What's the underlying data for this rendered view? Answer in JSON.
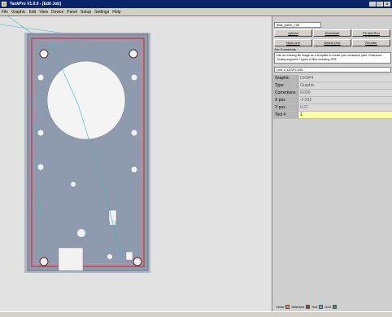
{
  "window": {
    "title": "TankPro V1.0.0 - [Edit Job]",
    "buttons": [
      "_",
      "□",
      "X"
    ]
  },
  "menu": {
    "items": [
      "File",
      "Graphic",
      "Edit",
      "View",
      "Device",
      "Panel",
      "Setup",
      "Settings",
      "Help"
    ]
  },
  "panel": {
    "job_name": "disa_panel_f.06",
    "buttons": {
      "upload": "Upload",
      "download": "Download",
      "fit_run": "Fit and Run",
      "new_line": "New Line",
      "delete_line": "Delete Line",
      "reorder": "Reorder"
    },
    "job_comments_label": "Job Comments",
    "job_comments": "Use an existing file image as a template to create your clearance path. Clearance Tooling supports 7 types of files including JPG.",
    "path_field": "Line 1: DISP4.006",
    "properties": [
      {
        "name": "Graphic",
        "value": "DXSP4"
      },
      {
        "name": "Type",
        "value": "Graphic"
      },
      {
        "name": "Corrections",
        "value": "0.000"
      },
      {
        "name": "X pos",
        "value": "-2.532"
      },
      {
        "name": "Y pos",
        "value": "0.27"
      },
      {
        "name": "Tool #",
        "value": "1"
      }
    ]
  },
  "legend": {
    "items": [
      {
        "label": "Draw",
        "color": "#e8923a"
      },
      {
        "label": "Selected",
        "color": "#d42020"
      },
      {
        "label": "Tool",
        "color": "#3fb7c9"
      },
      {
        "label": "Grid",
        "color": "#4a7f6b"
      }
    ]
  },
  "colors": {
    "titlebar": "#0a246a",
    "panel_plate": "#8e9aad",
    "outline_red": "#d02020",
    "tool_path": "#3fb7c9",
    "highlight": "#ffffa6"
  }
}
